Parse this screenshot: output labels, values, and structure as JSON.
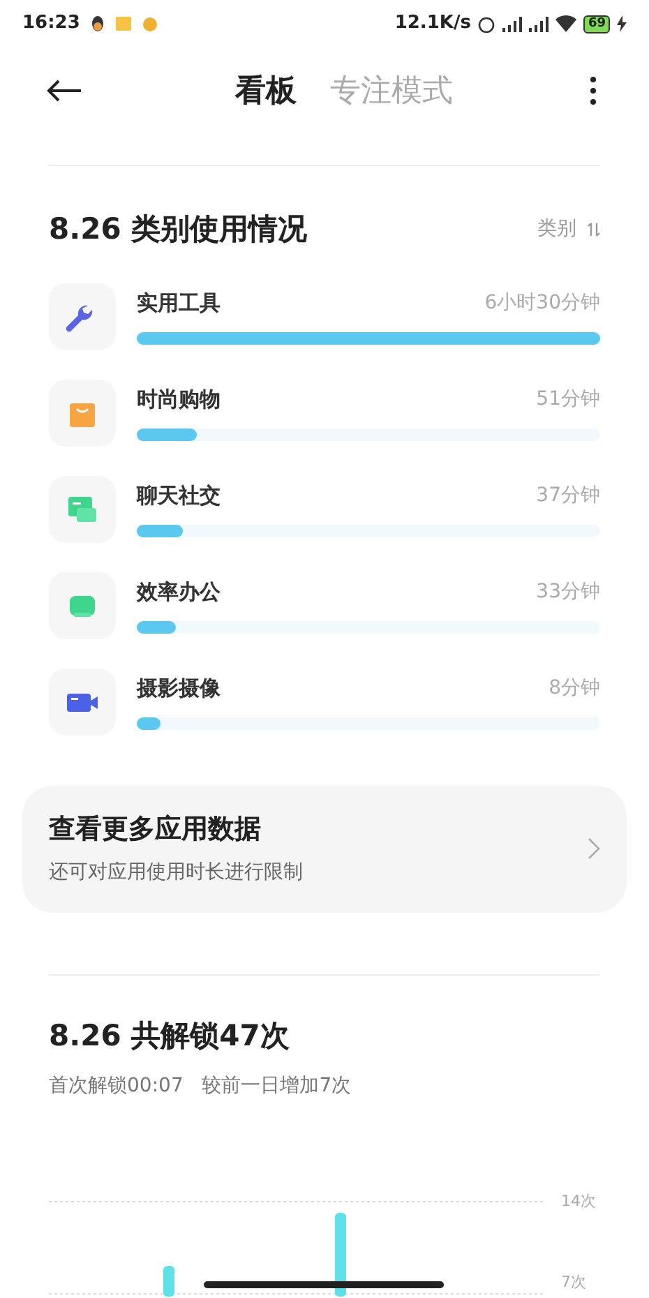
{
  "status_bar": {
    "time": "16:23",
    "speed": "12.1K/s",
    "battery": "69"
  },
  "header": {
    "tabs": [
      {
        "label": "看板",
        "selected": true
      },
      {
        "label": "专注模式",
        "selected": false
      }
    ]
  },
  "category_usage": {
    "title": "8.26 类别使用情况",
    "sort_label": "类别",
    "items": [
      {
        "kind": "tools",
        "name": "实用工具",
        "duration": "6小时30分钟",
        "level": 1
      },
      {
        "kind": "shopping",
        "name": "时尚购物",
        "duration": "51分钟",
        "level": 0.13
      },
      {
        "kind": "chat",
        "name": "聊天社交",
        "duration": "37分钟",
        "level": 0.1
      },
      {
        "kind": "office",
        "name": "效率办公",
        "duration": "33分钟",
        "level": 0.085
      },
      {
        "kind": "video",
        "name": "摄影摄像",
        "duration": "8分钟",
        "level": 0.05
      }
    ]
  },
  "more_card": {
    "title": "查看更多应用数据",
    "subtitle": "还可对应用使用时长进行限制"
  },
  "unlocks": {
    "title": "8.26 共解锁47次",
    "subtitle": "首次解锁00:07   较前一日增加7次",
    "tick_labels": [
      "14次",
      "7次"
    ]
  }
}
